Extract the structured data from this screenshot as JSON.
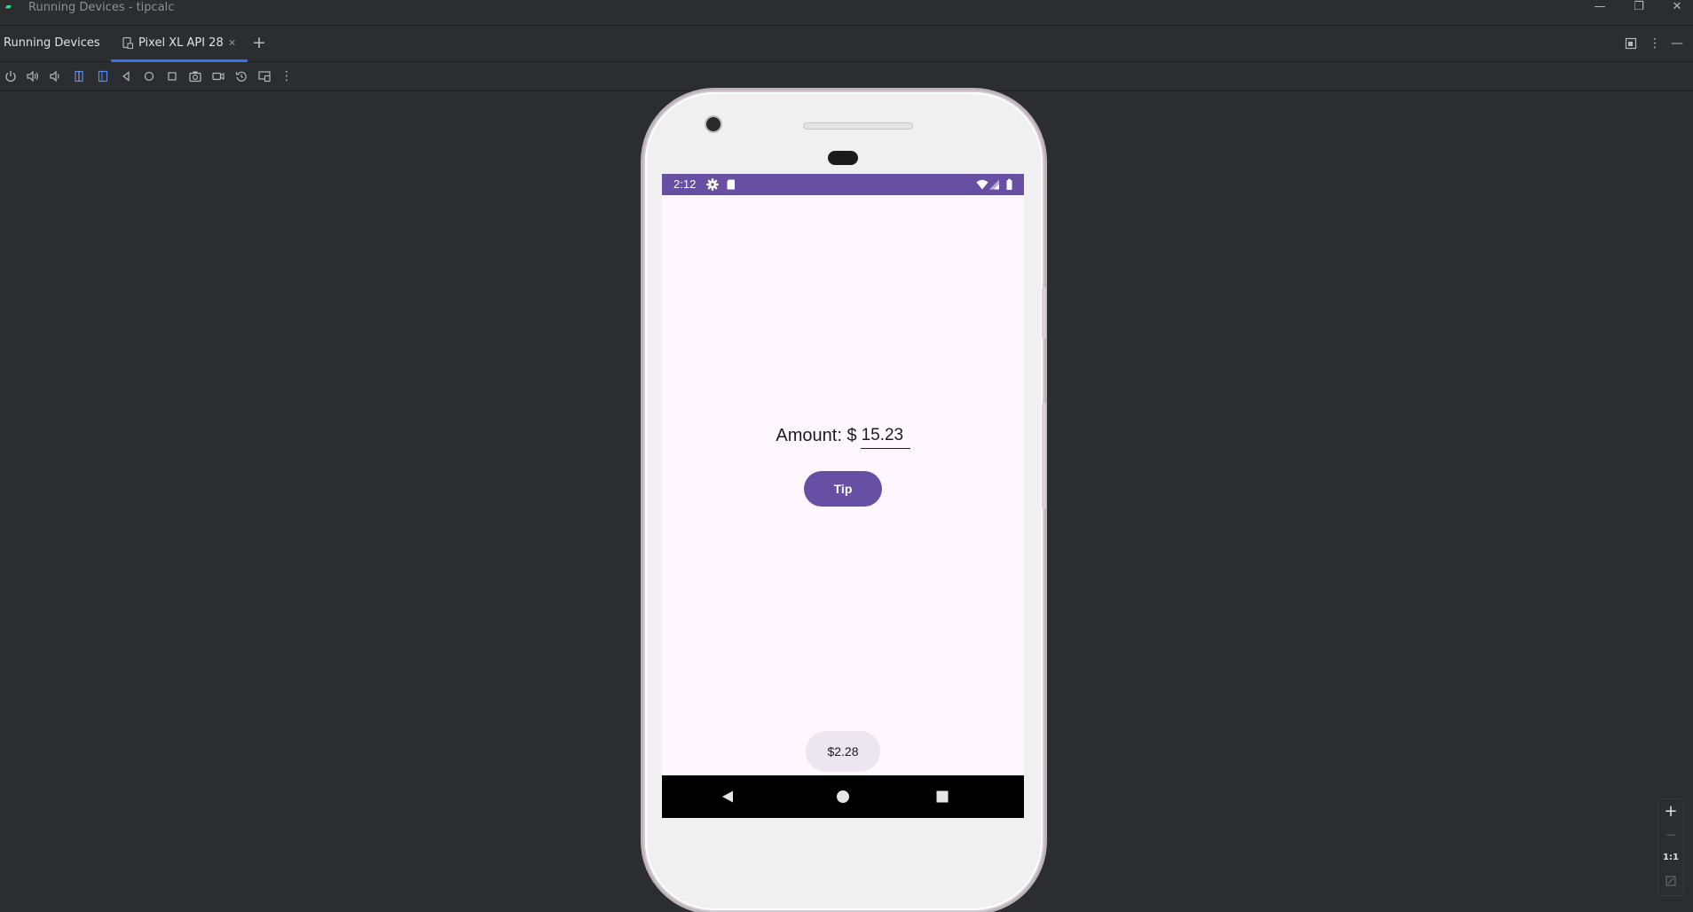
{
  "window": {
    "title": "Running Devices - tipcalc",
    "controls": [
      "minimize",
      "restore",
      "close"
    ]
  },
  "tool_window": {
    "title": "Running Devices",
    "tabs": [
      {
        "label": "Pixel XL API 28",
        "active": true
      }
    ]
  },
  "toolbar": {
    "buttons": [
      "power",
      "volume-up",
      "volume-down",
      "rotate-left",
      "rotate-right",
      "back",
      "home",
      "overview",
      "screenshot",
      "screen-record",
      "snapshots",
      "display-mode",
      "more"
    ]
  },
  "device": {
    "status_bar": {
      "time": "2:12",
      "color": "#6750a4"
    },
    "app": {
      "amount_label": "Amount: $",
      "amount_value": "15.23",
      "tip_button_label": "Tip",
      "tip_result": "$2.28",
      "primary_color": "#6750a4",
      "background_color": "#fef7ff"
    }
  },
  "zoom": {
    "zoom_in": "+",
    "zoom_out": "—",
    "actual_size": "1:1"
  },
  "colors": {
    "ide_background": "#2b2d30",
    "accent": "#3574f0"
  }
}
